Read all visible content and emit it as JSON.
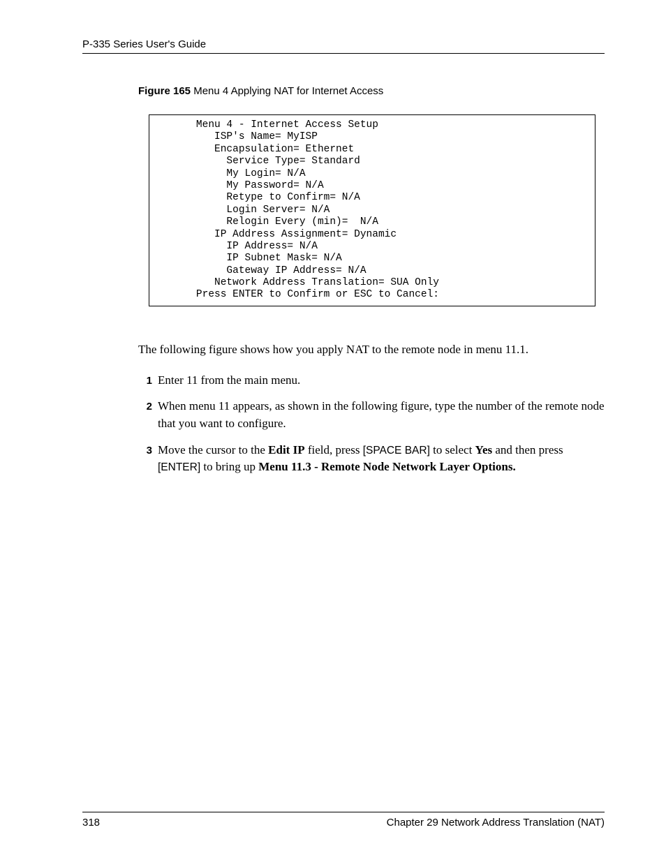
{
  "header": {
    "guide_title": "P-335 Series User's Guide"
  },
  "figure": {
    "label": "Figure 165",
    "title": "   Menu 4 Applying NAT for Internet Access"
  },
  "codebox": "       Menu 4 - Internet Access Setup\n          ISP's Name= MyISP\n          Encapsulation= Ethernet\n            Service Type= Standard\n            My Login= N/A\n            My Password= N/A\n            Retype to Confirm= N/A\n            Login Server= N/A\n            Relogin Every (min)=  N/A\n          IP Address Assignment= Dynamic\n            IP Address= N/A\n            IP Subnet Mask= N/A\n            Gateway IP Address= N/A\n          Network Address Translation= SUA Only\n       Press ENTER to Confirm or ESC to Cancel:",
  "body": {
    "intro": "The following figure shows how you apply NAT to the remote node in menu 11.1."
  },
  "steps": {
    "s1": {
      "num": "1",
      "text": "Enter 11 from the main menu."
    },
    "s2": {
      "num": "2",
      "text": "When menu 11 appears, as shown in the following figure, type the number of the remote node that you want to configure."
    },
    "s3": {
      "num": "3",
      "p1": "Move the cursor to the ",
      "b1": "Edit IP",
      "p2": " field, press ",
      "k1": "[SPACE BAR]",
      "p3": " to select ",
      "b2": "Yes",
      "p4": " and then press ",
      "k2": "[ENTER]",
      "p5": " to bring up ",
      "b3": "Menu 11.3 - Remote Node Network Layer Options."
    }
  },
  "footer": {
    "page": "318",
    "chapter": "Chapter 29 Network Address Translation (NAT)"
  }
}
